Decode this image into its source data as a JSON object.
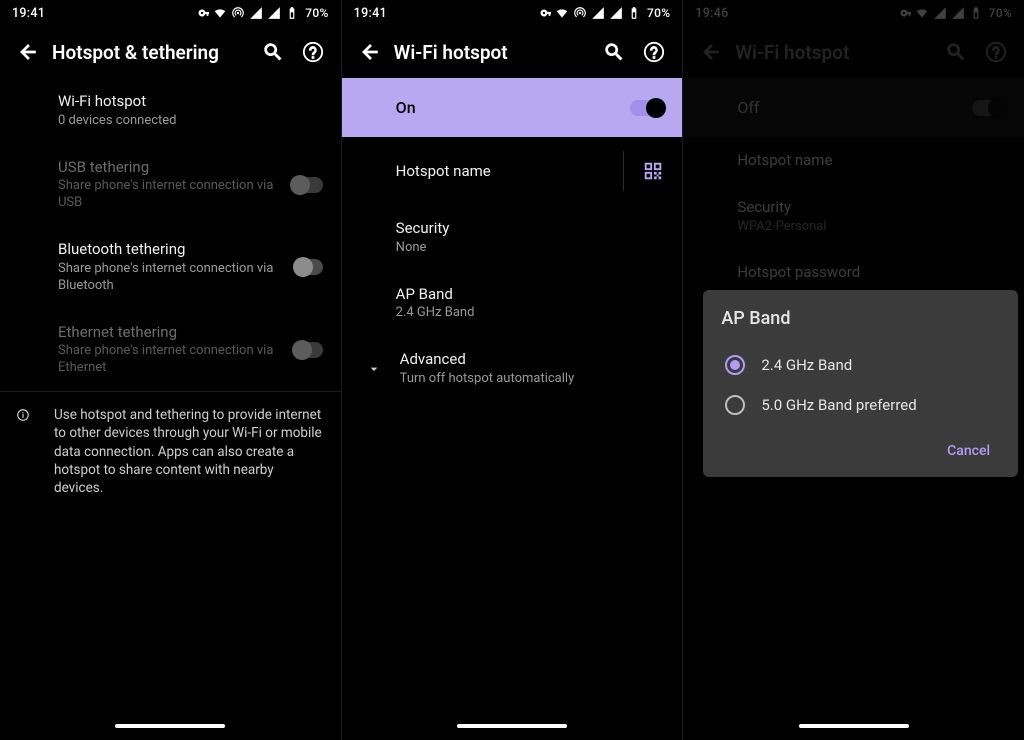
{
  "panel1": {
    "status": {
      "time": "19:41",
      "battery_text": "70%"
    },
    "header": {
      "title": "Hotspot & tethering"
    },
    "wifi_hotspot": {
      "title": "Wi-Fi hotspot",
      "subtitle": "0 devices connected"
    },
    "usb": {
      "title": "USB tethering",
      "subtitle": "Share phone's internet connection via USB"
    },
    "bluetooth": {
      "title": "Bluetooth tethering",
      "subtitle": "Share phone's internet connection via Bluetooth"
    },
    "ethernet": {
      "title": "Ethernet tethering",
      "subtitle": "Share phone's internet connection via Ethernet"
    },
    "info": "Use hotspot and tethering to provide internet to other devices through your Wi-Fi or mobile data connection. Apps can also create a hotspot to share content with nearby devices."
  },
  "panel2": {
    "status": {
      "time": "19:41",
      "battery_text": "70%"
    },
    "header": {
      "title": "Wi-Fi hotspot"
    },
    "on_label": "On",
    "hotspot_name": {
      "title": "Hotspot name"
    },
    "security": {
      "title": "Security",
      "value": "None"
    },
    "apband": {
      "title": "AP Band",
      "value": "2.4 GHz Band"
    },
    "advanced": {
      "title": "Advanced",
      "subtitle": "Turn off hotspot automatically"
    }
  },
  "panel3": {
    "status": {
      "time": "19:46",
      "battery_text": "70%"
    },
    "header": {
      "title": "Wi-Fi hotspot"
    },
    "off_label": "Off",
    "hotspot_name": {
      "title": "Hotspot name"
    },
    "security": {
      "title": "Security",
      "value": "WPA2-Personal"
    },
    "password": {
      "title": "Hotspot password"
    },
    "dialog": {
      "title": "AP Band",
      "opt1": "2.4 GHz Band",
      "opt2": "5.0 GHz Band preferred",
      "cancel": "Cancel"
    }
  }
}
